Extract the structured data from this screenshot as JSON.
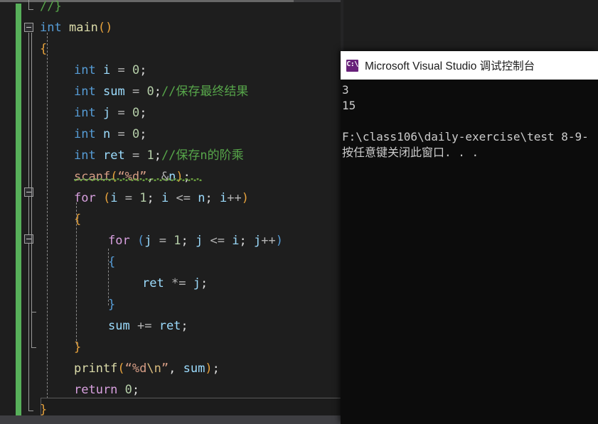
{
  "editor": {
    "language": "c",
    "theme": "visual-studio-dark",
    "change_bar_color": "#57b05a",
    "background_color": "#1e1e1e",
    "lines": [
      {
        "indent": 0,
        "text": "//}"
      },
      {
        "indent": 0,
        "text": "int main()"
      },
      {
        "indent": 0,
        "text": "{"
      },
      {
        "indent": 1,
        "text": "int i = 0;"
      },
      {
        "indent": 1,
        "text": "int sum = 0;//保存最终结果"
      },
      {
        "indent": 1,
        "text": "int j = 0;"
      },
      {
        "indent": 1,
        "text": "int n = 0;"
      },
      {
        "indent": 1,
        "text": "int ret = 1;//保存n的阶乘"
      },
      {
        "indent": 1,
        "text": "scanf(“%d”, &n);"
      },
      {
        "indent": 1,
        "text": "for (i = 1; i <= n; i++)"
      },
      {
        "indent": 1,
        "text": "{"
      },
      {
        "indent": 2,
        "text": "for (j = 1; j <= i; j++)"
      },
      {
        "indent": 2,
        "text": "{"
      },
      {
        "indent": 3,
        "text": "ret *= j;"
      },
      {
        "indent": 2,
        "text": "}"
      },
      {
        "indent": 2,
        "text": "sum += ret;"
      },
      {
        "indent": 1,
        "text": "}"
      },
      {
        "indent": 1,
        "text": "printf(“%d\\n”, sum);"
      },
      {
        "indent": 1,
        "text": "return 0;"
      },
      {
        "indent": 0,
        "text": "}"
      }
    ],
    "comments": {
      "comment_1": "//保存最终结果",
      "comment_2": "//保存n的阶乘",
      "comment_top": "//}"
    },
    "tokens": {
      "keyword_int": "int",
      "keyword_for": "for",
      "keyword_return": "return",
      "func_main": "main",
      "func_scanf": "scanf",
      "func_printf": "printf",
      "var_i": "i",
      "var_j": "j",
      "var_n": "n",
      "var_sum": "sum",
      "var_ret": "ret",
      "fmt_scanf": "“%d”",
      "fmt_printf": "“%d\\n”"
    },
    "colors": {
      "keyword": "#569cd6",
      "control": "#d8a0df",
      "identifier": "#9cdcfe",
      "number": "#b5cea8",
      "comment": "#57a64a",
      "function": "#dcdcaa",
      "string": "#d69d85",
      "escape": "#d7ba7d",
      "squiggle": "#6a9f3f"
    },
    "outlining": {
      "collapse_markers": 2,
      "marker_glyph": "minus-square"
    }
  },
  "console": {
    "title": "Microsoft Visual Studio 调试控制台",
    "icon_name": "cmd-console-icon",
    "icon_glyph": "C:\\",
    "icon_color": "#68217a",
    "titlebar_background": "#ffffff",
    "background": "#0c0c0c",
    "foreground": "#cccccc",
    "lines": [
      "3",
      "15",
      "",
      "F:\\class106\\daily-exercise\\test 8-9-",
      "按任意键关闭此窗口. . ."
    ],
    "input_value": "3",
    "output_value": "15",
    "exit_path": "F:\\class106\\daily-exercise\\test 8-9-",
    "exit_prompt": "按任意键关闭此窗口. . ."
  },
  "scrollbars": {
    "top_thumb_label": "horizontal-scroll-thumb",
    "bottom_thumb_label": "horizontal-scroll-thumb"
  }
}
